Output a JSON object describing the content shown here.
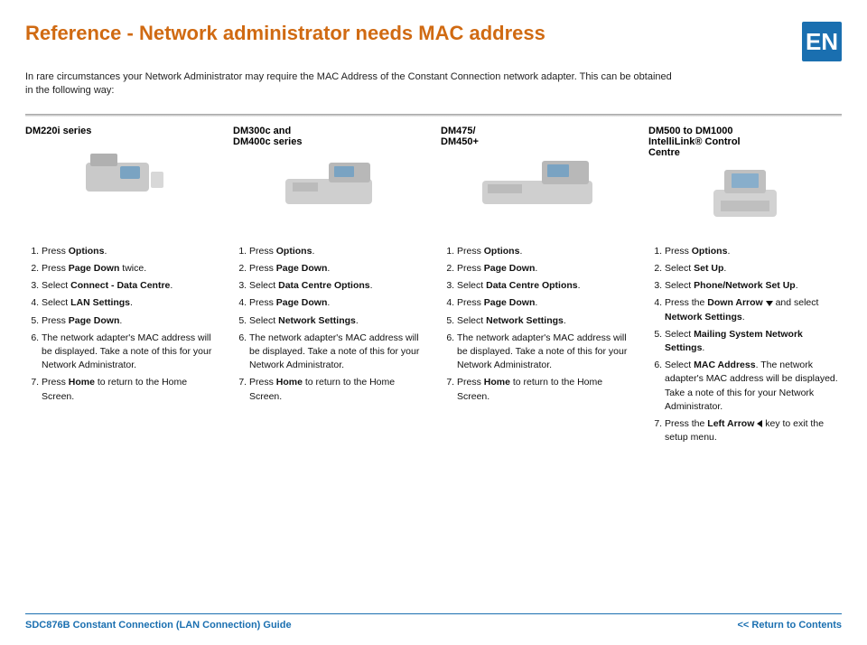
{
  "lang_badge": "EN",
  "title": "Reference - Network administrator needs MAC address",
  "intro": "In rare circumstances your Network Administrator may require the MAC Address of the Constant Connection network adapter. This can be obtained in the following way:",
  "models": [
    {
      "label": "DM220i series"
    },
    {
      "label": "DM300c and\nDM400c series"
    },
    {
      "label": "DM475/\nDM450+"
    },
    {
      "label": "DM500 to DM1000\nIntelliLink® Control\nCentre"
    }
  ],
  "steps_col1": [
    "Press <b>Options</b>.",
    "Press <b>Page Down</b> twice.",
    "Select <b>Connect - Data Centre</b>.",
    "Select <b>LAN Settings</b>.",
    "Press <b>Page Down</b>.",
    "The network adapter's MAC address will be displayed. Take a note of this for your Network Administrator.",
    "Press <b>Home</b> to return to the Home Screen."
  ],
  "steps_col2": [
    "Press <b>Options</b>.",
    "Press <b>Page Down</b>.",
    "Select <b>Data Centre Options</b>.",
    "Press <b>Page Down</b>.",
    "Select <b>Network Settings</b>.",
    "The network adapter's MAC address will be displayed. Take a note of this for your Network Administrator.",
    "Press <b>Home</b> to return to the Home Screen."
  ],
  "steps_col3": [
    "Press <b>Options</b>.",
    "Press <b>Page Down</b>.",
    "Select <b>Data Centre Options</b>.",
    "Press <b>Page Down</b>.",
    "Select <b>Network Settings</b>.",
    "The network adapter's MAC address will be displayed. Take a note of this for your Network Administrator.",
    "Press <b>Home</b> to return to the Home Screen."
  ],
  "steps_col4": [
    "Press <b>Options</b>.",
    "Select <b>Set Up</b>.",
    "Select <b>Phone/Network Set Up</b>.",
    "Press the <b>Down Arrow</b> ▼ and select <b>Network Settings</b>.",
    "Select <b>Mailing System Network Settings</b>.",
    "Select <b>MAC Address</b>. The network adapter's MAC address will be displayed. Take a note of this for your Network Administrator.",
    "Press the <b>Left Arrow</b> ◀ key to exit the setup menu."
  ],
  "footer": {
    "doc_title": "SDC876B Constant Connection (LAN Connection) Guide",
    "return_label": "<< Return to Contents"
  }
}
